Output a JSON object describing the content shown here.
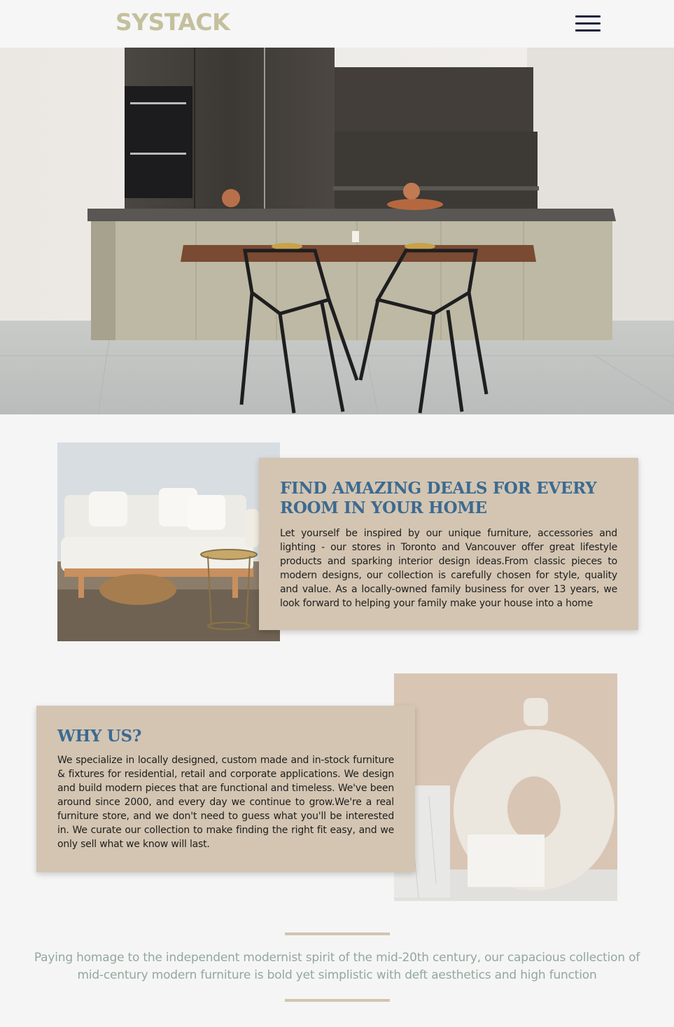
{
  "header": {
    "logo": "SYSTACK",
    "menu_icon": "hamburger-menu-icon"
  },
  "hero": {
    "image": "modern-kitchen-with-island-and-black-chairs"
  },
  "section_deals": {
    "image": "white-sofa-living-room",
    "title": "FIND AMAZING DEALS FOR EVERY ROOM IN YOUR HOME",
    "text": "Let yourself be inspired by our unique furniture, accessories and lighting - our stores in Toronto and Vancouver offer great lifestyle products and sparking interior design ideas.From classic pieces to modern designs, our collection is carefully chosen for style, quality and value. As a locally-owned family business for over 13 years, we look forward to helping your family make your house into a home"
  },
  "section_why": {
    "image": "white-ceramic-donut-vase",
    "title": "WHY US?",
    "text": "We specialize in locally designed, custom made and in-stock furniture & fixtures for residential, retail and corporate applications. We design and build modern pieces that are functional and timeless. We've been around since 2000, and every day we continue to grow.We're a real furniture store, and we don't need to guess what you'll be interested in. We curate our collection to make finding the right fit easy, and we only sell what we know will last."
  },
  "footer_quote": {
    "text": "Paying homage to the independent modernist spirit of the mid-20th century, our capacious collection of mid-century modern furniture is bold yet simplistic with deft aesthetics and high function"
  },
  "colors": {
    "logo": "#c4c09d",
    "hamburger": "#14213d",
    "card_bg": "#d3c5b2",
    "card_title": "#3b6a91",
    "quote_text": "#93a89c",
    "rule": "#d2c4b1",
    "page_bg": "#f5f5f5"
  }
}
